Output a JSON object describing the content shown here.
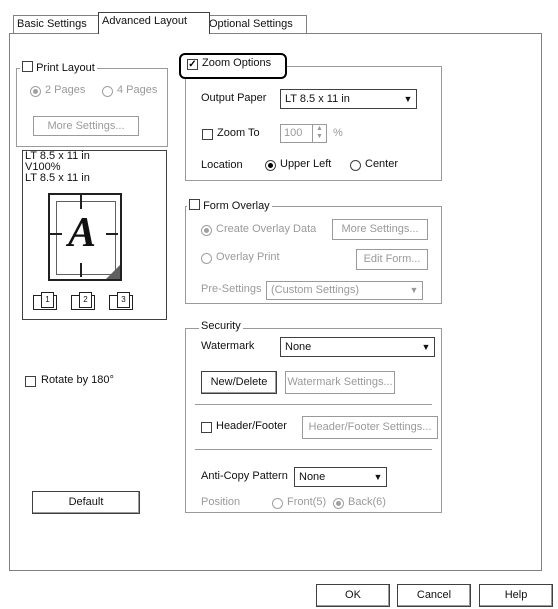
{
  "tabs": [
    {
      "label": "Basic Settings"
    },
    {
      "label": "Advanced Layout"
    },
    {
      "label": "Optional Settings"
    }
  ],
  "print_layout": {
    "label": "Print Layout",
    "checked": false,
    "radio_2pages": "2 Pages",
    "radio_4pages": "4 Pages",
    "more_settings": "More Settings..."
  },
  "preview": {
    "line1": "LT 8.5 x 11 in",
    "line2": "V100%",
    "line3": "LT 8.5 x 11 in",
    "glyph": "A"
  },
  "rotate": {
    "label": "Rotate by 180°",
    "checked": false
  },
  "default_button": "Default",
  "zoom": {
    "label": "Zoom Options",
    "checked": true,
    "output_paper_label": "Output Paper",
    "output_paper_value": "LT 8.5 x 11 in",
    "zoom_to_label": "Zoom To",
    "zoom_to_value": "100",
    "percent": "%",
    "location_label": "Location",
    "upper_left": "Upper Left",
    "center": "Center"
  },
  "form_overlay": {
    "label": "Form Overlay",
    "checked": false,
    "create_overlay": "Create Overlay Data",
    "more_settings": "More Settings...",
    "overlay_print": "Overlay Print",
    "edit_form": "Edit Form...",
    "pre_settings_label": "Pre-Settings",
    "pre_settings_value": "(Custom Settings)"
  },
  "security": {
    "title": "Security",
    "watermark_label": "Watermark",
    "watermark_value": "None",
    "new_delete": "New/Delete",
    "watermark_settings": "Watermark Settings...",
    "header_footer_label": "Header/Footer",
    "header_footer_checked": false,
    "header_footer_settings": "Header/Footer Settings...",
    "anti_copy_label": "Anti-Copy Pattern",
    "anti_copy_value": "None",
    "position_label": "Position",
    "front": "Front(5)",
    "back": "Back(6)"
  },
  "dialog_buttons": {
    "ok": "OK",
    "cancel": "Cancel",
    "help": "Help"
  }
}
